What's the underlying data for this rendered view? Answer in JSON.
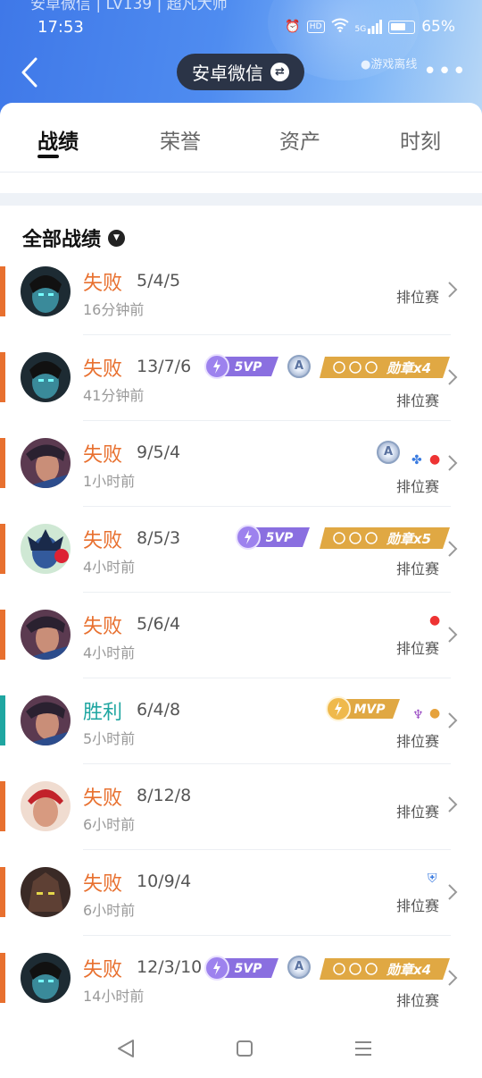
{
  "status_bar": {
    "top_cut_text": "安卓微信 | LV139 | 超凡大师",
    "time": "17:53",
    "hd": "HD",
    "network": "5G",
    "battery": "65%"
  },
  "header": {
    "title": "安卓微信",
    "offline_label": "●游戏离线",
    "more": "•••"
  },
  "tabs": [
    {
      "label": "战绩"
    },
    {
      "label": "荣誉"
    },
    {
      "label": "资产"
    },
    {
      "label": "时刻"
    }
  ],
  "section": {
    "title": "全部战绩"
  },
  "badges": {
    "svp": "5VP",
    "mvp": "MVP",
    "a": "A"
  },
  "matches": [
    {
      "result": "失败",
      "kda": "5/4/5",
      "time_ago": "16分钟前",
      "mode": "排位赛",
      "medal": ""
    },
    {
      "result": "失败",
      "kda": "13/7/6",
      "time_ago": "41分钟前",
      "mode": "排位赛",
      "medal": "勋章x4"
    },
    {
      "result": "失败",
      "kda": "9/5/4",
      "time_ago": "1小时前",
      "mode": "排位赛",
      "medal": ""
    },
    {
      "result": "失败",
      "kda": "8/5/3",
      "time_ago": "4小时前",
      "mode": "排位赛",
      "medal": "勋章x5"
    },
    {
      "result": "失败",
      "kda": "5/6/4",
      "time_ago": "4小时前",
      "mode": "排位赛",
      "medal": ""
    },
    {
      "result": "胜利",
      "kda": "6/4/8",
      "time_ago": "5小时前",
      "mode": "排位赛",
      "medal": ""
    },
    {
      "result": "失败",
      "kda": "8/12/8",
      "time_ago": "6小时前",
      "mode": "排位赛",
      "medal": ""
    },
    {
      "result": "失败",
      "kda": "10/9/4",
      "time_ago": "6小时前",
      "mode": "排位赛",
      "medal": ""
    },
    {
      "result": "失败",
      "kda": "12/3/10",
      "time_ago": "14小时前",
      "mode": "排位赛",
      "medal": "勋章x4"
    }
  ],
  "colors": {
    "lose": "#e8702f",
    "win": "#1fa6a1",
    "header": "#4f8cf0"
  }
}
